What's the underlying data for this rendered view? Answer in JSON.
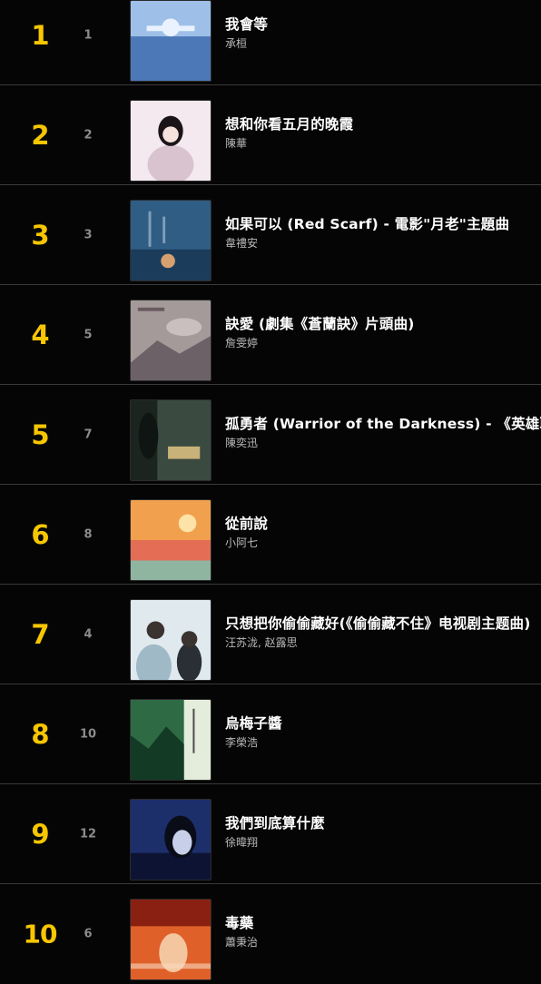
{
  "chart": {
    "entries": [
      {
        "rank": "1",
        "previous_rank": "1",
        "title": "我會等",
        "artist": "承桓",
        "cover_colors": [
          "#9ec0e8",
          "#4d78b8",
          "#eaf2ff"
        ]
      },
      {
        "rank": "2",
        "previous_rank": "2",
        "title": "想和你看五月的晚霞",
        "artist": "陳華",
        "cover_colors": [
          "#f3e9ee",
          "#d9c3cf",
          "#1a1418"
        ]
      },
      {
        "rank": "3",
        "previous_rank": "3",
        "title": "如果可以 (Red Scarf) - 電影\"月老\"主題曲",
        "artist": "韋禮安",
        "cover_colors": [
          "#2f5d84",
          "#1c3c5c",
          "#d6a070"
        ]
      },
      {
        "rank": "4",
        "previous_rank": "5",
        "title": "訣愛 (劇集《蒼蘭訣》片頭曲)",
        "artist": "詹雯婷",
        "cover_colors": [
          "#a59a9a",
          "#6d6168",
          "#c9bfbf"
        ]
      },
      {
        "rank": "5",
        "previous_rank": "7",
        "title": "孤勇者 (Warrior of the Darkness) - 《英雄聯盟》",
        "artist": "陳奕迅",
        "cover_colors": [
          "#3a4a40",
          "#1b241f",
          "#c9b27a"
        ]
      },
      {
        "rank": "6",
        "previous_rank": "8",
        "title": "從前說",
        "artist": "小阿七",
        "cover_colors": [
          "#f1a14d",
          "#e36d55",
          "#8fb4a0"
        ]
      },
      {
        "rank": "7",
        "previous_rank": "4",
        "title": "只想把你偷偷藏好(《偷偷藏不住》电视剧主题曲)",
        "artist": "汪苏泷, 赵露思",
        "cover_colors": [
          "#dfe9ee",
          "#9fb9c7",
          "#2a2f36"
        ]
      },
      {
        "rank": "8",
        "previous_rank": "10",
        "title": "烏梅子醬",
        "artist": "李榮浩",
        "cover_colors": [
          "#2e6a44",
          "#133a24",
          "#e4ecdc"
        ]
      },
      {
        "rank": "9",
        "previous_rank": "12",
        "title": "我們到底算什麼",
        "artist": "徐暐翔",
        "cover_colors": [
          "#1d2f6b",
          "#0d1433",
          "#c7d0e8"
        ]
      },
      {
        "rank": "10",
        "previous_rank": "6",
        "title": "毒藥",
        "artist": "蕭秉治",
        "cover_colors": [
          "#e0602a",
          "#8a2012",
          "#f4c6a0"
        ]
      }
    ]
  }
}
